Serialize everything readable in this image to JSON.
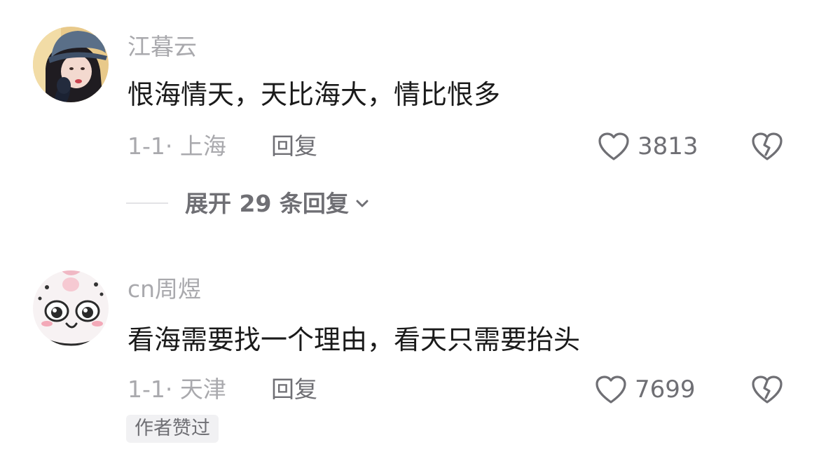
{
  "comments": [
    {
      "username": "江暮云",
      "content": "恨海情天，天比海大，情比恨多",
      "meta": "1-1· 上海",
      "reply_label": "回复",
      "likes": "3813",
      "replies_label": "展开 29 条回复"
    },
    {
      "username": "cn周煜",
      "content": "看海需要找一个理由，看天只需要抬头",
      "meta": "1-1· 天津",
      "reply_label": "回复",
      "likes": "7699",
      "badge": "作者赞过"
    }
  ],
  "icons": {
    "like": "heart-outline-icon",
    "dislike": "broken-heart-icon",
    "expand": "chevron-down-icon"
  },
  "colors": {
    "secondary_text": "#a9a9ad",
    "action_text": "#6f6f74",
    "badge_bg": "#f1f1f3"
  }
}
